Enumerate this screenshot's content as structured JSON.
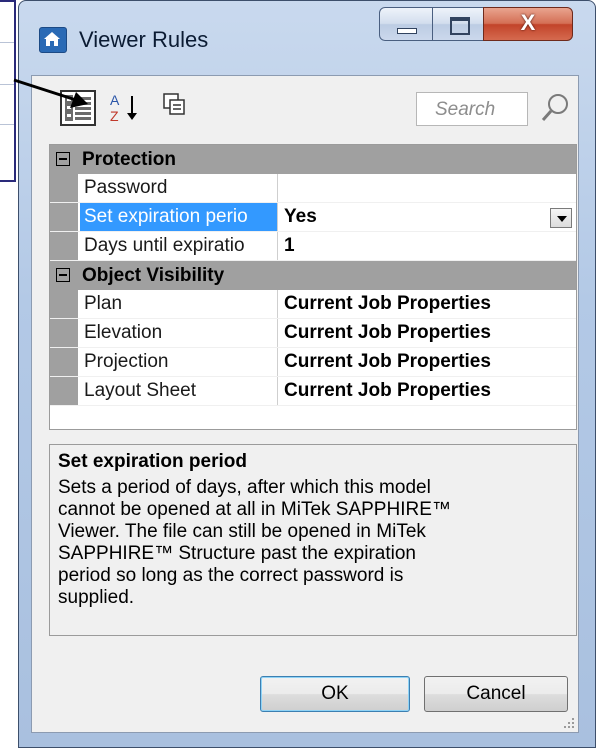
{
  "window": {
    "title": "Viewer Rules",
    "close_glyph": "X"
  },
  "toolbar": {
    "search_placeholder": "Search"
  },
  "grid": {
    "categories": [
      {
        "label": "Protection",
        "rows": [
          {
            "name": "Password",
            "value": ""
          },
          {
            "name": "Set expiration perio",
            "value": "Yes"
          },
          {
            "name": "Days until expiratio",
            "value": "1"
          }
        ]
      },
      {
        "label": "Object Visibility",
        "rows": [
          {
            "name": "Plan",
            "value": "Current Job Properties"
          },
          {
            "name": "Elevation",
            "value": "Current Job Properties"
          },
          {
            "name": "Projection",
            "value": "Current Job Properties"
          },
          {
            "name": "Layout Sheet",
            "value": "Current Job Properties"
          }
        ]
      }
    ]
  },
  "description": {
    "title": "Set expiration period",
    "lines": [
      "Sets a period of days, after which this model",
      "cannot be opened at all in MiTek SAPPHIRE™",
      "Viewer. The file can still be opened in MiTek",
      "SAPPHIRE™ Structure past the expiration",
      "period so long as the correct password is",
      "supplied."
    ]
  },
  "buttons": {
    "ok": "OK",
    "cancel": "Cancel"
  },
  "colors": {
    "selection": "#3399ff",
    "category_bg": "#a0a0a0",
    "close_button": "#c2442a"
  }
}
